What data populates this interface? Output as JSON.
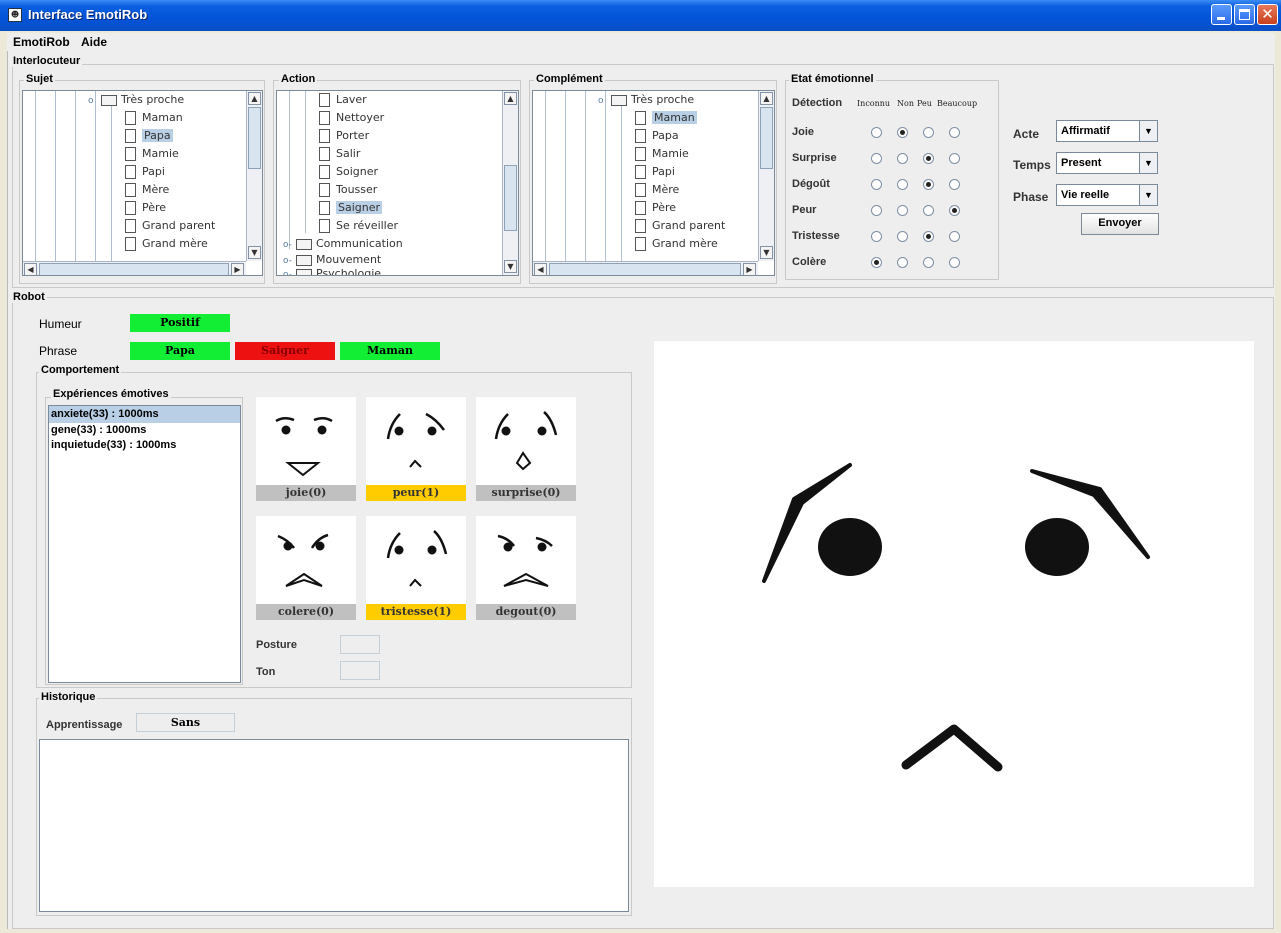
{
  "window": {
    "title": "Interface EmotiRob"
  },
  "menu": [
    "EmotiRob",
    "Aide"
  ],
  "interlocuteur": {
    "label": "Interlocuteur",
    "sujet": {
      "label": "Sujet",
      "parent": "Très proche",
      "items": [
        "Maman",
        "Papa",
        "Mamie",
        "Papi",
        "Mère",
        "Père",
        "Grand parent",
        "Grand mère"
      ],
      "selected": "Papa"
    },
    "action": {
      "label": "Action",
      "items": [
        "Laver",
        "Nettoyer",
        "Porter",
        "Salir",
        "Soigner",
        "Tousser",
        "Saigner",
        "Se réveiller"
      ],
      "folders": [
        "Communication",
        "Mouvement",
        "Psychologie"
      ],
      "selected": "Saigner"
    },
    "complement": {
      "label": "Complément",
      "parent": "Très proche",
      "items": [
        "Maman",
        "Papa",
        "Mamie",
        "Papi",
        "Mère",
        "Père",
        "Grand parent",
        "Grand mère"
      ],
      "selected": "Maman"
    },
    "etat": {
      "label": "Etat émotionnel",
      "detection_label": "Détection",
      "columns": [
        "Inconnu",
        "Non",
        "Peu",
        "Beaucoup"
      ],
      "rows": [
        {
          "name": "Joie",
          "selected": 1
        },
        {
          "name": "Surprise",
          "selected": 2
        },
        {
          "name": "Dégoût",
          "selected": 2
        },
        {
          "name": "Peur",
          "selected": 3
        },
        {
          "name": "Tristesse",
          "selected": 2
        },
        {
          "name": "Colère",
          "selected": 0
        }
      ]
    },
    "acte": {
      "label": "Acte",
      "value": "Affirmatif"
    },
    "temps": {
      "label": "Temps",
      "value": "Present"
    },
    "phase": {
      "label": "Phase",
      "value": "Vie reelle"
    },
    "send_label": "Envoyer"
  },
  "robot": {
    "label": "Robot",
    "humeur": {
      "label": "Humeur",
      "value": "Positif",
      "color": "#11ee33"
    },
    "phrase": {
      "label": "Phrase",
      "parts": [
        {
          "text": "Papa",
          "color": "#11ee33"
        },
        {
          "text": "Saigner",
          "color": "#ee1111"
        },
        {
          "text": "Maman",
          "color": "#11ee33"
        }
      ]
    },
    "comportement": {
      "label": "Comportement",
      "experiences_label": "Expériences émotives",
      "experiences": [
        "anxiete(33) : 1000ms",
        "gene(33) : 1000ms",
        "inquietude(33) : 1000ms"
      ],
      "faces": [
        {
          "caption": "joie(0)",
          "active": false
        },
        {
          "caption": "peur(1)",
          "active": true
        },
        {
          "caption": "surprise(0)",
          "active": false
        },
        {
          "caption": "colere(0)",
          "active": false
        },
        {
          "caption": "tristesse(1)",
          "active": true
        },
        {
          "caption": "degout(0)",
          "active": false
        }
      ],
      "active_color": "#ffcc00",
      "inactive_color": "#c0c0c0",
      "posture_label": "Posture",
      "ton_label": "Ton"
    },
    "historique": {
      "label": "Historique",
      "apprentissage_label": "Apprentissage",
      "apprentissage_value": "Sans"
    }
  }
}
